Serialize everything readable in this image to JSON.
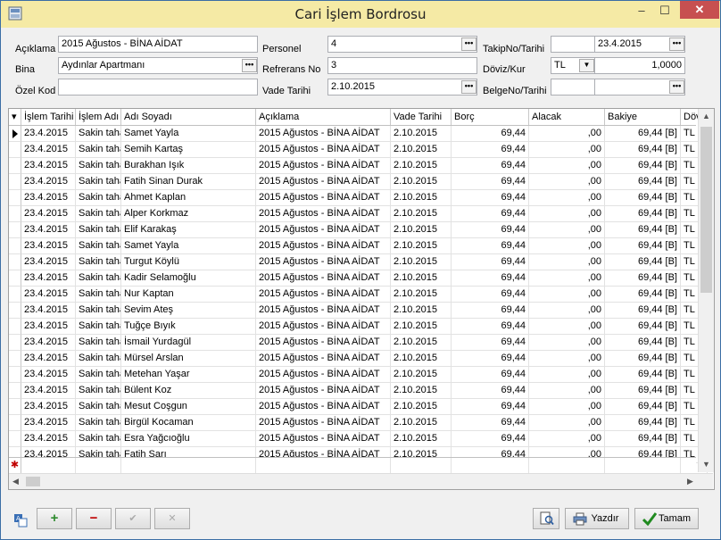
{
  "window": {
    "title": "Cari İşlem Bordrosu",
    "min": "‒",
    "max": "☐",
    "close": "✕"
  },
  "form": {
    "aciklama_label": "Açıklama",
    "aciklama_value": "2015 Ağustos - BİNA AİDAT",
    "bina_label": "Bina",
    "bina_value": "Aydınlar Apartmanı",
    "ozelkod_label": "Özel Kod",
    "ozelkod_value": "",
    "personel_label": "Personel",
    "personel_value": "4",
    "refno_label": "Refrerans No",
    "refno_value": "3",
    "vade_label": "Vade Tarihi",
    "vade_value": "2.10.2015",
    "takip_label": "TakipNo/Tarihi",
    "takip_no": "",
    "takip_tarih": "23.4.2015",
    "doviz_label": "Döviz/Kur",
    "doviz_value": "TL",
    "kur_value": "1,0000",
    "belge_label": "BelgeNo/Tarihi",
    "belge_no": "",
    "belge_tarih": "",
    "ellipsis": "•••"
  },
  "grid": {
    "columns": [
      "İşlem Tarihi",
      "İşlem Adı",
      "Adı Soyadı",
      "Açıklama",
      "Vade Tarihi",
      "Borç",
      "Alacak",
      "Bakiye",
      "Döv"
    ],
    "rows": [
      [
        "23.4.2015",
        "Sakin tahakkuk",
        "Samet Yayla",
        "2015 Ağustos - BİNA AİDAT",
        "2.10.2015",
        "69,44",
        ",00",
        "69,44 [B]",
        "TL"
      ],
      [
        "23.4.2015",
        "Sakin tahakkuk",
        "Semih  Kartaş",
        "2015 Ağustos - BİNA AİDAT",
        "2.10.2015",
        "69,44",
        ",00",
        "69,44 [B]",
        "TL"
      ],
      [
        "23.4.2015",
        "Sakin tahakkuk",
        "Burakhan Işık",
        "2015 Ağustos - BİNA AİDAT",
        "2.10.2015",
        "69,44",
        ",00",
        "69,44 [B]",
        "TL"
      ],
      [
        "23.4.2015",
        "Sakin tahakkuk",
        "Fatih Sinan Durak",
        "2015 Ağustos - BİNA AİDAT",
        "2.10.2015",
        "69,44",
        ",00",
        "69,44 [B]",
        "TL"
      ],
      [
        "23.4.2015",
        "Sakin tahakkuk",
        "Ahmet Kaplan",
        "2015 Ağustos - BİNA AİDAT",
        "2.10.2015",
        "69,44",
        ",00",
        "69,44 [B]",
        "TL"
      ],
      [
        "23.4.2015",
        "Sakin tahakkuk",
        "Alper  Korkmaz",
        "2015 Ağustos - BİNA AİDAT",
        "2.10.2015",
        "69,44",
        ",00",
        "69,44 [B]",
        "TL"
      ],
      [
        "23.4.2015",
        "Sakin tahakkuk",
        "Elif Karakaş",
        "2015 Ağustos - BİNA AİDAT",
        "2.10.2015",
        "69,44",
        ",00",
        "69,44 [B]",
        "TL"
      ],
      [
        "23.4.2015",
        "Sakin tahakkuk",
        "Samet Yayla",
        "2015 Ağustos - BİNA AİDAT",
        "2.10.2015",
        "69,44",
        ",00",
        "69,44 [B]",
        "TL"
      ],
      [
        "23.4.2015",
        "Sakin tahakkuk",
        "Turgut  Köylü",
        "2015 Ağustos - BİNA AİDAT",
        "2.10.2015",
        "69,44",
        ",00",
        "69,44 [B]",
        "TL"
      ],
      [
        "23.4.2015",
        "Sakin tahakkuk",
        "Kadir Selamoğlu",
        "2015 Ağustos - BİNA AİDAT",
        "2.10.2015",
        "69,44",
        ",00",
        "69,44 [B]",
        "TL"
      ],
      [
        "23.4.2015",
        "Sakin tahakkuk",
        "Nur  Kaptan",
        "2015 Ağustos - BİNA AİDAT",
        "2.10.2015",
        "69,44",
        ",00",
        "69,44 [B]",
        "TL"
      ],
      [
        "23.4.2015",
        "Sakin tahakkuk",
        "Sevim  Ateş",
        "2015 Ağustos - BİNA AİDAT",
        "2.10.2015",
        "69,44",
        ",00",
        "69,44 [B]",
        "TL"
      ],
      [
        "23.4.2015",
        "Sakin tahakkuk",
        "Tuğçe  Bıyık",
        "2015 Ağustos - BİNA AİDAT",
        "2.10.2015",
        "69,44",
        ",00",
        "69,44 [B]",
        "TL"
      ],
      [
        "23.4.2015",
        "Sakin tahakkuk",
        "İsmail  Yurdagül",
        "2015 Ağustos - BİNA AİDAT",
        "2.10.2015",
        "69,44",
        ",00",
        "69,44 [B]",
        "TL"
      ],
      [
        "23.4.2015",
        "Sakin tahakkuk",
        "Mürsel Arslan",
        "2015 Ağustos - BİNA AİDAT",
        "2.10.2015",
        "69,44",
        ",00",
        "69,44 [B]",
        "TL"
      ],
      [
        "23.4.2015",
        "Sakin tahakkuk",
        "Metehan  Yaşar",
        "2015 Ağustos - BİNA AİDAT",
        "2.10.2015",
        "69,44",
        ",00",
        "69,44 [B]",
        "TL"
      ],
      [
        "23.4.2015",
        "Sakin tahakkuk",
        "Bülent Koz",
        "2015 Ağustos - BİNA AİDAT",
        "2.10.2015",
        "69,44",
        ",00",
        "69,44 [B]",
        "TL"
      ],
      [
        "23.4.2015",
        "Sakin tahakkuk",
        "Mesut Coşgun",
        "2015 Ağustos - BİNA AİDAT",
        "2.10.2015",
        "69,44",
        ",00",
        "69,44 [B]",
        "TL"
      ],
      [
        "23.4.2015",
        "Sakin tahakkuk",
        "Birgül  Kocaman",
        "2015 Ağustos - BİNA AİDAT",
        "2.10.2015",
        "69,44",
        ",00",
        "69,44 [B]",
        "TL"
      ],
      [
        "23.4.2015",
        "Sakin tahakkuk",
        "Esra Yağcıoğlu",
        "2015 Ağustos - BİNA AİDAT",
        "2.10.2015",
        "69,44",
        ",00",
        "69,44 [B]",
        "TL"
      ],
      [
        "23.4.2015",
        "Sakin tahakkuk",
        "Fatih Sarı",
        "2015 Ağustos - BİNA AİDAT",
        "2.10.2015",
        "69,44",
        ",00",
        "69,44 [B]",
        "TL"
      ]
    ]
  },
  "toolbar": {
    "add": "+",
    "remove": "−",
    "confirm": "✔",
    "cancel": "✕",
    "print_label": "Yazdır",
    "done_label": "Tamam"
  },
  "colors": {
    "accent_green": "#2e8b2e",
    "accent_red": "#c00000",
    "title_bg": "#f5eaa5"
  }
}
